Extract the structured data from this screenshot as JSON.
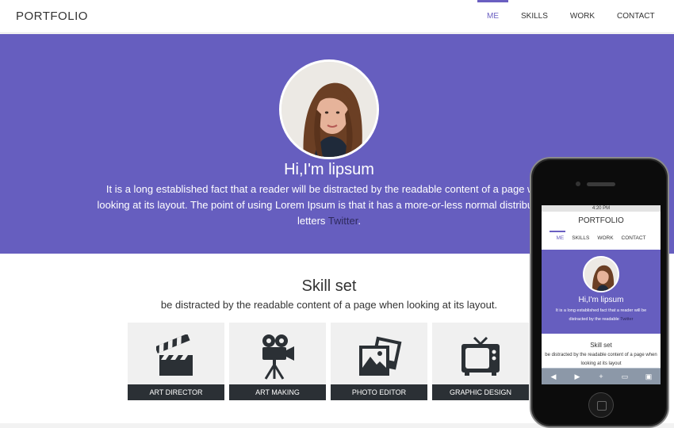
{
  "header": {
    "logo": "PORTFOLIO",
    "nav": [
      {
        "label": "ME",
        "active": true
      },
      {
        "label": "SKILLS",
        "active": false
      },
      {
        "label": "WORK",
        "active": false
      },
      {
        "label": "CONTACT",
        "active": false
      }
    ]
  },
  "hero": {
    "title": "Hi,I'm lipsum",
    "text": "It is a long established fact that a reader will be distracted by the readable content of a page when looking at its layout. The point of using Lorem Ipsum is that it has a more-or-less normal distribution of letters",
    "link": "Twitter",
    "after_link": "."
  },
  "skills": {
    "title": "Skill set",
    "subtitle": "be distracted by the readable content of a page when looking at its layout.",
    "tiles": [
      {
        "caption": "ART DIRECTOR",
        "icon": "clapperboard-icon"
      },
      {
        "caption": "ART MAKING",
        "icon": "film-camera-icon"
      },
      {
        "caption": "PHOTO EDITOR",
        "icon": "photos-icon"
      },
      {
        "caption": "GRAPHIC DESIGN",
        "icon": "television-icon"
      }
    ]
  },
  "mobile": {
    "time": "4:20 PM",
    "logo": "PORTFOLIO",
    "nav": [
      "ME",
      "SKILLS",
      "WORK",
      "CONTACT"
    ],
    "title": "Hi,I'm lipsum",
    "text": "It is a long established fact that a reader will be distracted by the readable",
    "link": "Twitter",
    "skill_title": "Skill set",
    "skill_sub": "be distracted by the readable content of a page when looking at its layout"
  },
  "colors": {
    "accent": "#665ebf",
    "caption_bar": "#2b3035",
    "tile_bg": "#f0f0f0"
  }
}
